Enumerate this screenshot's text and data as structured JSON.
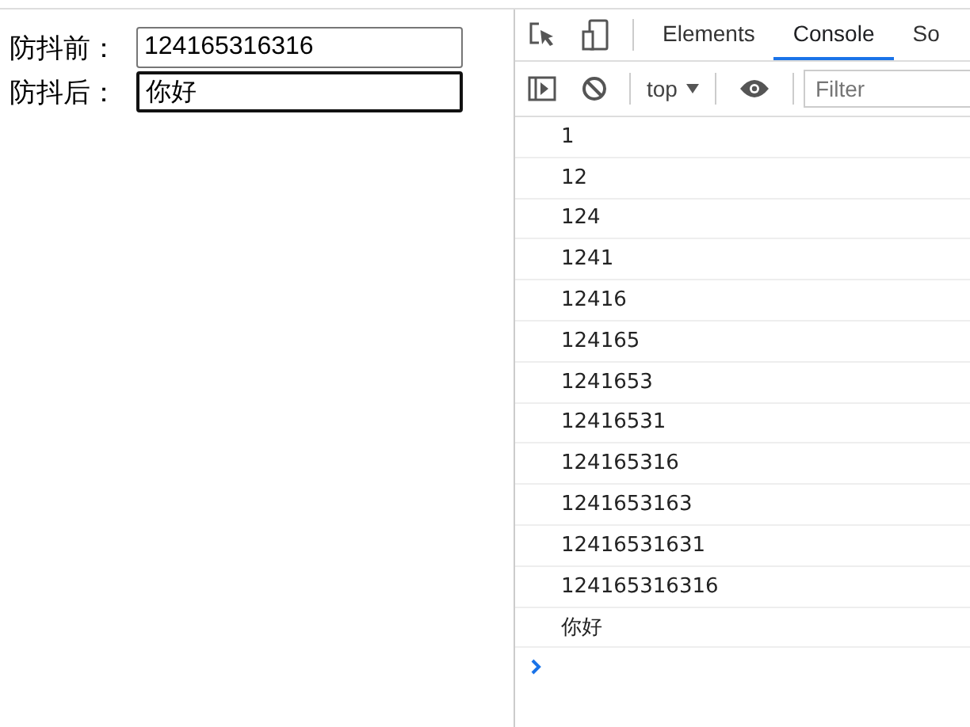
{
  "form": {
    "fields": [
      {
        "label": "防抖前：",
        "value": "124165316316",
        "focused": false
      },
      {
        "label": "防抖后：",
        "value": "你好",
        "focused": true
      }
    ]
  },
  "devtools": {
    "tabs": [
      {
        "label": "Elements",
        "selected": false
      },
      {
        "label": "Console",
        "selected": true
      },
      {
        "label": "So",
        "selected": false
      }
    ],
    "context": "top",
    "filter": {
      "placeholder": "Filter"
    },
    "log": [
      "1",
      "12",
      "124",
      "1241",
      "12416",
      "124165",
      "1241653",
      "12416531",
      "124165316",
      "1241653163",
      "12416531631",
      "124165316316",
      "你好"
    ]
  }
}
